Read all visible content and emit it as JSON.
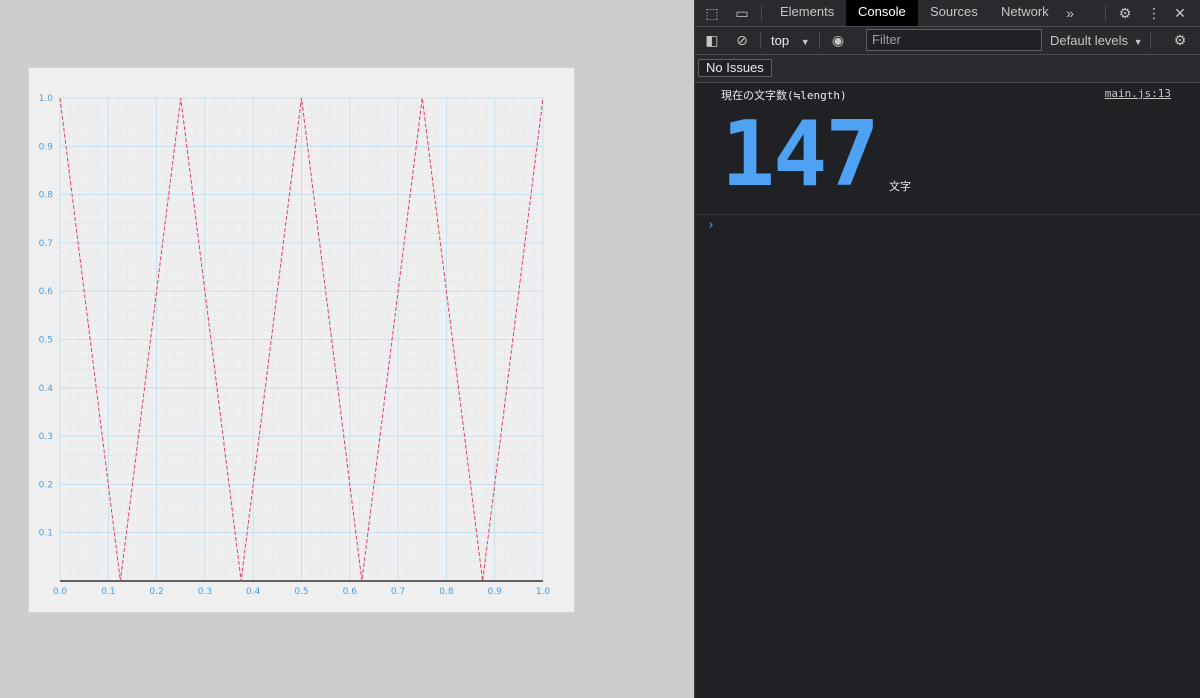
{
  "chart_data": {
    "type": "line",
    "x": [
      0,
      0.125,
      0.25,
      0.375,
      0.5,
      0.625,
      0.75,
      0.875,
      1.0
    ],
    "series": [
      {
        "values": [
          1,
          0,
          1,
          0,
          1,
          0,
          1,
          0,
          1
        ],
        "color": "#e0406a",
        "style": "dashed"
      }
    ],
    "xlim": [
      0,
      1
    ],
    "ylim": [
      0,
      1
    ],
    "xticks": [
      "0.0",
      "0.1",
      "0.2",
      "0.3",
      "0.4",
      "0.5",
      "0.6",
      "0.7",
      "0.8",
      "0.9",
      "1.0"
    ],
    "yticks": [
      "0.1",
      "0.2",
      "0.3",
      "0.4",
      "0.5",
      "0.6",
      "0.7",
      "0.8",
      "0.9",
      "1.0"
    ],
    "grid": true,
    "colors": {
      "major_grid": "#bcdcf2",
      "minor_grid": "#e2e6ea",
      "axis": "#333333",
      "tick_label": "#4a9fe0"
    }
  },
  "devtools": {
    "tabs": [
      "Elements",
      "Console",
      "Sources",
      "Network"
    ],
    "active_tab": "Console",
    "more_icon": "chevron-double-right-icon",
    "context": "top",
    "filter_placeholder": "Filter",
    "levels": "Default levels",
    "issues": "No Issues",
    "message": {
      "label": "現在の文字数(≒length)",
      "source": "main.js:13",
      "value": "147",
      "unit": "文字"
    },
    "prompt": "›"
  }
}
